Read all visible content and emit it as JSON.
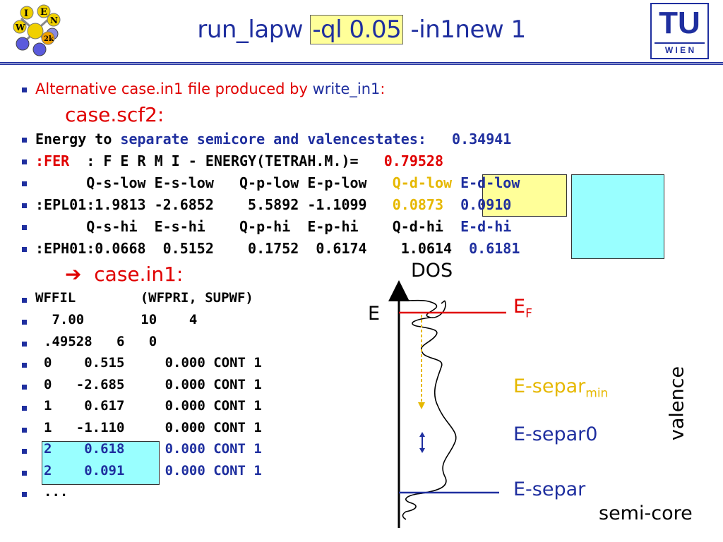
{
  "title": {
    "prefix": "run_lapw ",
    "highlight": "-ql 0.05",
    "suffix": " -in1new 1"
  },
  "logo_left": {
    "letters": [
      "I",
      "E",
      "W",
      "N",
      "2k"
    ]
  },
  "logo_right": {
    "top": "TU",
    "bottom": "W I E N"
  },
  "intro": {
    "text": "Alternative case.in1 file produced by ",
    "link": "write_in1",
    "colon": ":"
  },
  "scf_heading": "case.scf2:",
  "scf_lines": {
    "energy_a": "Energy to ",
    "energy_b": "separate semicore and valencestates:",
    "energy_c": "0.34941",
    "fer_a": ":FER",
    "fer_b": "  : F E R M I - ENERGY(TETRAH.M.)=",
    "fer_c": "0.79528",
    "hdr_low": "      Q-s-low E-s-low   Q-p-low E-p-low   ",
    "hdr_low_qd": "Q-d-low",
    "hdr_low_ed": "E-d-low",
    "epl": ":EPL01:1.9813 -2.6852    5.5892 -1.1099  ",
    "epl_qd": "0.0873",
    "epl_ed": "0.0910",
    "hdr_hi": "      Q-s-hi  E-s-hi    Q-p-hi  E-p-hi    Q-d-hi ",
    "hdr_hi_ed": "E-d-hi",
    "eph": ":EPH01:0.0668  0.5152    0.1752  0.6174    1.0614 ",
    "eph_ed": "0.6181"
  },
  "in1_arrow": "➔",
  "in1_heading": "case.in1:",
  "in1_lines": [
    "WFFIL        (WFPRI, SUPWF)",
    " 7.00       10    4",
    ".49528   6   0",
    "0    0.515     0.000 CONT 1",
    "0   -2.685     0.000 CONT 1",
    "1    0.617     0.000 CONT 1",
    "1   -1.110     0.000 CONT 1",
    "2    0.618     0.000 CONT 1",
    "2    0.091     0.000 CONT 1",
    "..."
  ],
  "diagram": {
    "dos_label": "DOS",
    "e_label": "E",
    "ef_label": "E",
    "ef_sub": "F",
    "esepmin_label": "E-separ",
    "esepmin_sub": "min",
    "esep0_label": "E-separ0",
    "esep_label": "E-separ",
    "valence": "valence",
    "semicore": "semi-core",
    "colors": {
      "fermi": "#e00000",
      "separ": "#1f2f9f",
      "min": "#e6b800"
    }
  }
}
